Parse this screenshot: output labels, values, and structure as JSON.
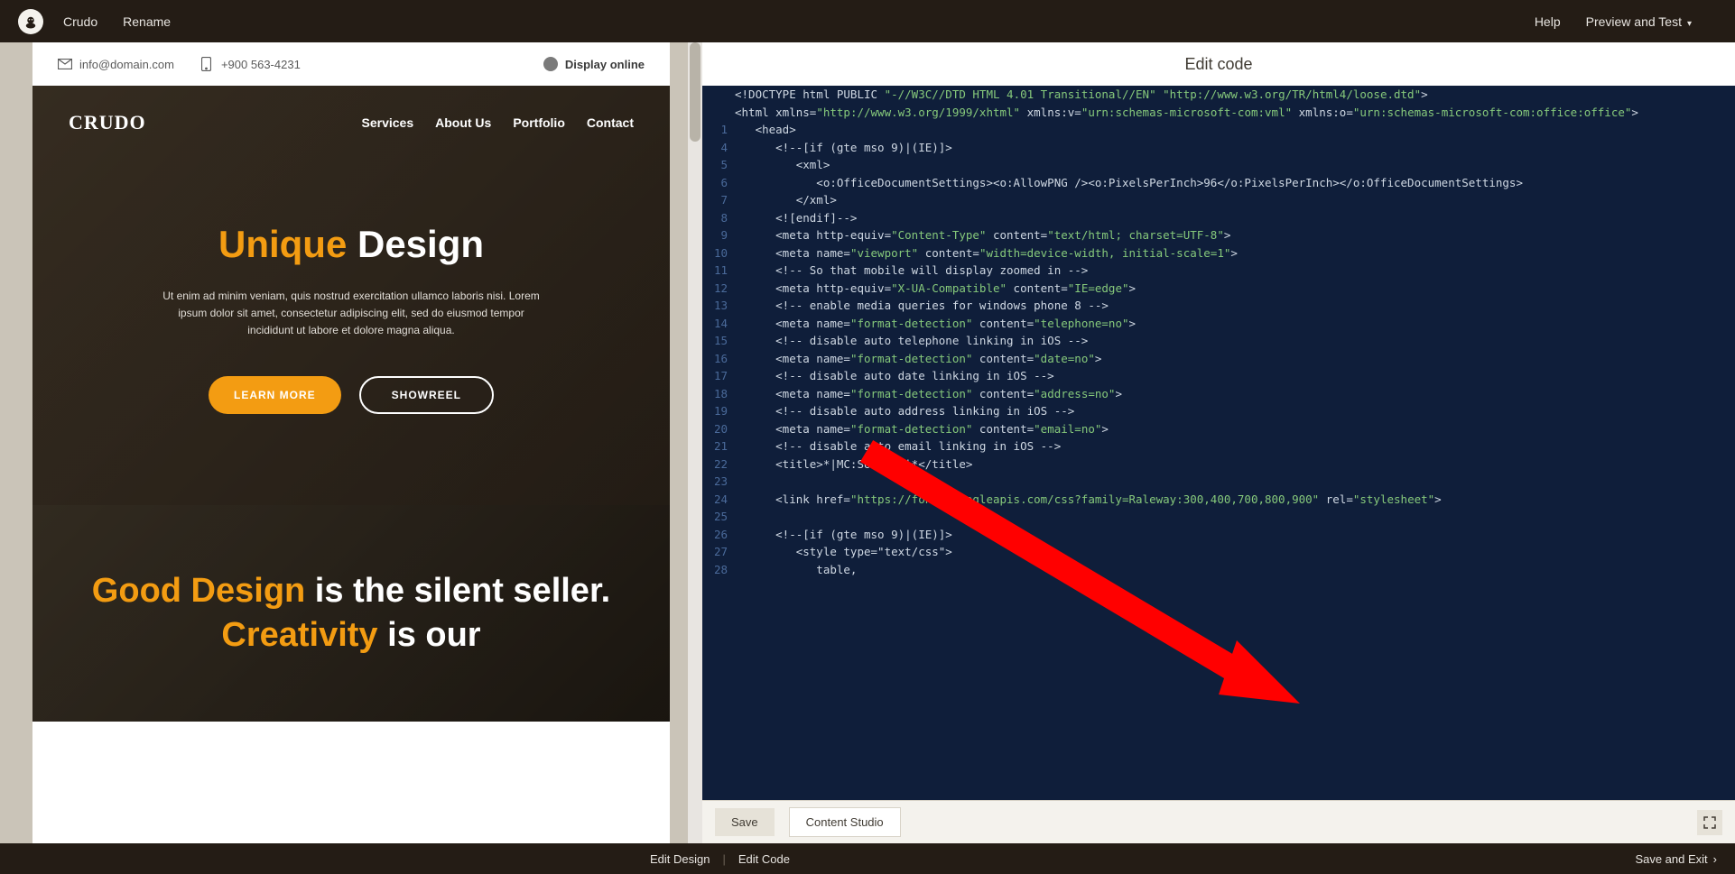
{
  "topbar": {
    "brand": "Crudo",
    "rename": "Rename",
    "help": "Help",
    "preview": "Preview and Test"
  },
  "preview": {
    "email": "info@domain.com",
    "phone": "+900 563-4231",
    "display": "Display online",
    "logo": "CRUDO",
    "nav": [
      "Services",
      "About Us",
      "Portfolio",
      "Contact"
    ],
    "hero_a": "Unique",
    "hero_b": "Design",
    "hero_sub": "Ut enim ad minim veniam, quis nostrud exercitation ullamco laboris nisi. Lorem ipsum dolor sit amet, consectetur adipiscing elit, sed do eiusmod tempor incididunt ut labore et dolore magna aliqua.",
    "btn_learn": "LEARN MORE",
    "btn_reel": "SHOWREEL",
    "sec2_html": "<span class='orange'>Good Design</span> is the silent seller. <span class='orange'>Creativity</span> is our"
  },
  "right_header": "Edit code",
  "code": [
    {
      "n": "",
      "t": "<!DOCTYPE html PUBLIC ",
      "s": "\"-//W3C//DTD HTML 4.01 Transitional//EN\" \"http://www.w3.org/TR/html4/loose.dtd\"",
      "e": ">"
    },
    {
      "n": "",
      "wrap": true,
      "parts": [
        {
          "plain": "<html xmlns="
        },
        {
          "str": "\"http://www.w3.org/1999/xhtml\""
        },
        {
          "plain": " xmlns:v="
        },
        {
          "str": "\"urn:schemas-microsoft-com:vml\""
        },
        {
          "plain": " xmlns:o="
        },
        {
          "str": "\"urn:schemas-microsoft-com:office:office\""
        },
        {
          "plain": ">"
        }
      ]
    },
    {
      "n": "1",
      "t": "   <head>"
    },
    {
      "n": "4",
      "t": "      <!--[if (gte mso 9)|(IE)]>"
    },
    {
      "n": "5",
      "t": "         <xml>"
    },
    {
      "n": "6",
      "t": "            <o:OfficeDocumentSettings><o:AllowPNG /><o:PixelsPerInch>96</o:PixelsPerInch></o:OfficeDocumentSettings>"
    },
    {
      "n": "7",
      "t": "         </xml>"
    },
    {
      "n": "8",
      "t": "      <![endif]-->"
    },
    {
      "n": "9",
      "parts": [
        {
          "plain": "      <meta http-equiv="
        },
        {
          "str": "\"Content-Type\""
        },
        {
          "plain": " content="
        },
        {
          "str": "\"text/html; charset=UTF-8\""
        },
        {
          "plain": ">"
        }
      ]
    },
    {
      "n": "10",
      "parts": [
        {
          "plain": "      <meta name="
        },
        {
          "str": "\"viewport\""
        },
        {
          "plain": " content="
        },
        {
          "str": "\"width=device-width, initial-scale=1\""
        },
        {
          "plain": ">"
        }
      ]
    },
    {
      "n": "11",
      "t": "      <!-- So that mobile will display zoomed in -->"
    },
    {
      "n": "12",
      "parts": [
        {
          "plain": "      <meta http-equiv="
        },
        {
          "str": "\"X-UA-Compatible\""
        },
        {
          "plain": " content="
        },
        {
          "str": "\"IE=edge\""
        },
        {
          "plain": ">"
        }
      ]
    },
    {
      "n": "13",
      "t": "      <!-- enable media queries for windows phone 8 -->"
    },
    {
      "n": "14",
      "parts": [
        {
          "plain": "      <meta name="
        },
        {
          "str": "\"format-detection\""
        },
        {
          "plain": " content="
        },
        {
          "str": "\"telephone=no\""
        },
        {
          "plain": ">"
        }
      ]
    },
    {
      "n": "15",
      "t": "      <!-- disable auto telephone linking in iOS -->"
    },
    {
      "n": "16",
      "parts": [
        {
          "plain": "      <meta name="
        },
        {
          "str": "\"format-detection\""
        },
        {
          "plain": " content="
        },
        {
          "str": "\"date=no\""
        },
        {
          "plain": ">"
        }
      ]
    },
    {
      "n": "17",
      "t": "      <!-- disable auto date linking in iOS -->"
    },
    {
      "n": "18",
      "parts": [
        {
          "plain": "      <meta name="
        },
        {
          "str": "\"format-detection\""
        },
        {
          "plain": " content="
        },
        {
          "str": "\"address=no\""
        },
        {
          "plain": ">"
        }
      ]
    },
    {
      "n": "19",
      "t": "      <!-- disable auto address linking in iOS -->"
    },
    {
      "n": "20",
      "parts": [
        {
          "plain": "      <meta name="
        },
        {
          "str": "\"format-detection\""
        },
        {
          "plain": " content="
        },
        {
          "str": "\"email=no\""
        },
        {
          "plain": ">"
        }
      ]
    },
    {
      "n": "21",
      "t": "      <!-- disable auto email linking in iOS -->"
    },
    {
      "n": "22",
      "t": "      <title>*|MC:SUBJECT|*</title>"
    },
    {
      "n": "23",
      "t": ""
    },
    {
      "n": "24",
      "parts": [
        {
          "plain": "      <link href="
        },
        {
          "str": "\"https://fonts.googleapis.com/css?family=Raleway:300,400,700,800,900\""
        },
        {
          "plain": " rel="
        },
        {
          "str": "\"stylesheet\""
        },
        {
          "plain": ">"
        }
      ]
    },
    {
      "n": "25",
      "t": ""
    },
    {
      "n": "26",
      "t": "      <!--[if (gte mso 9)|(IE)]>"
    },
    {
      "n": "27",
      "t": "         <style type=\"text/css\">"
    },
    {
      "n": "28",
      "t": "            table,"
    }
  ],
  "actions": {
    "save": "Save",
    "studio": "Content Studio"
  },
  "bottom": {
    "edit_design": "Edit Design",
    "edit_code": "Edit Code",
    "save_exit": "Save and Exit"
  }
}
